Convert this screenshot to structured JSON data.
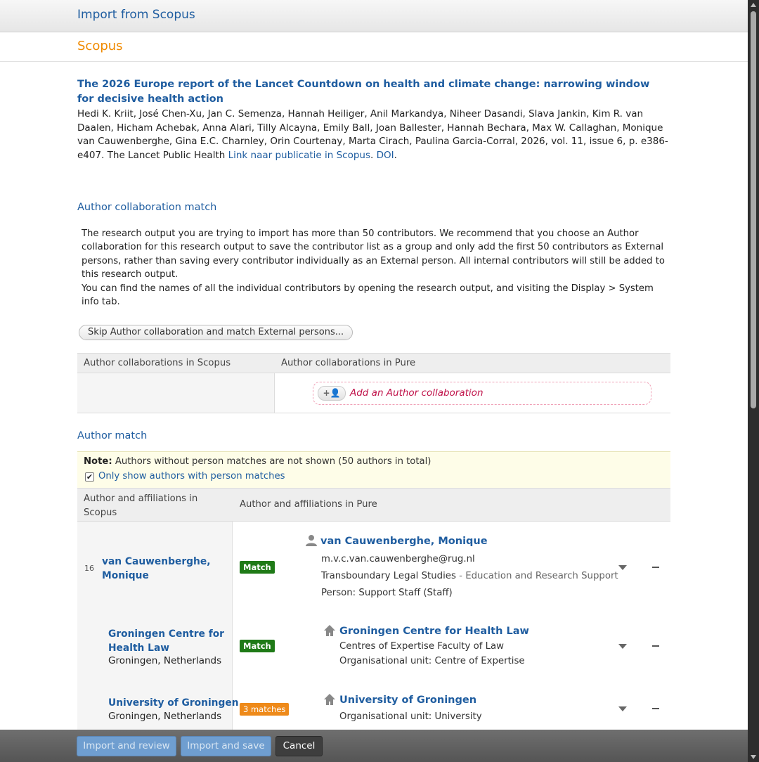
{
  "window": {
    "title": "Import from Scopus"
  },
  "source": {
    "name": "Scopus"
  },
  "publication": {
    "title": "The 2026 Europe report of the Lancet Countdown on health and climate change: narrowing window for decisive health action",
    "citation": "Hedi K. Kriit, José Chen-Xu, Jan C. Semenza, Hannah Heiliger, Anil Markandya, Niheer Dasandi, Slava Jankin, Kim R. van Daalen, Hicham Achebak, Anna Alari, Tilly Alcayna, Emily Ball, Joan Ballester, Hannah Bechara, Max W. Callaghan, Monique van Cauwenberghe, Gina E.C. Charnley, Orin Courtenay, Marta Cirach, Paulina Garcia-Corral, 2026, vol. 11, issue 6, p. e386-e407. The Lancet Public Health ",
    "link_scopus": "Link naar publicatie in Scopus",
    "sep": ". ",
    "link_doi": "DOI",
    "end": "."
  },
  "collab": {
    "section_title": "Author collaboration match",
    "notice_p1": "The research output you are trying to import has more than 50 contributors. We recommend that you choose an Author collaboration for this research output to save the contributor list as a group and only add the first 50 contributors as External persons, rather than saving every contributor individually as an External person. All internal contributors will still be added to this research output.",
    "notice_p2": "You can find the names of all the individual contributors by opening the research output, and visiting the Display > System info tab.",
    "skip_button": "Skip Author collaboration and match External persons...",
    "col_scopus": "Author collaborations in Scopus",
    "col_pure": "Author collaborations in Pure",
    "add_button": "Add an Author collaboration",
    "add_pill": "+👤"
  },
  "author_match": {
    "section_title": "Author match",
    "note_label": "Note:",
    "note_text": " Authors without person matches are not shown (50 authors in total)",
    "checkbox_label": "Only show authors with person matches",
    "checkbox_mark": "✔",
    "col_scopus": "Author and affiliations in Scopus",
    "col_pure": "Author and affiliations in Pure",
    "rows": [
      {
        "index": "16",
        "name_line1": "van Cauwenberghe,",
        "name_line2": "Monique",
        "badge": "Match",
        "pure_name": "van Cauwenberghe, Monique",
        "email": "m.v.c.van.cauwenberghe@rug.nl",
        "dept": "Transboundary Legal Studies",
        "dept_sep": " - ",
        "dept_grey": "Education and Research Support",
        "type": "Person: Support Staff (Staff)"
      },
      {
        "name_line1": "Groningen Centre for",
        "name_line2": "Health Law",
        "place": "Groningen, Netherlands",
        "badge": "Match",
        "pure_name": "Groningen Centre for Health Law",
        "line1": "Centres of Expertise Faculty of Law",
        "line2": "Organisational unit: Centre of Expertise"
      },
      {
        "name_line1": "University of Groningen",
        "place": "Groningen, Netherlands",
        "badge": "3 matches",
        "pure_name": "University of Groningen",
        "line1": "Organisational unit: University"
      }
    ]
  },
  "footer": {
    "import_review": "Import and review",
    "import_save": "Import and save",
    "cancel": "Cancel"
  },
  "colors": {
    "link": "#1f5da0",
    "brand": "#f08a00",
    "match": "#1f7a17",
    "multi": "#ee8a1a",
    "collab": "#c0134a"
  }
}
